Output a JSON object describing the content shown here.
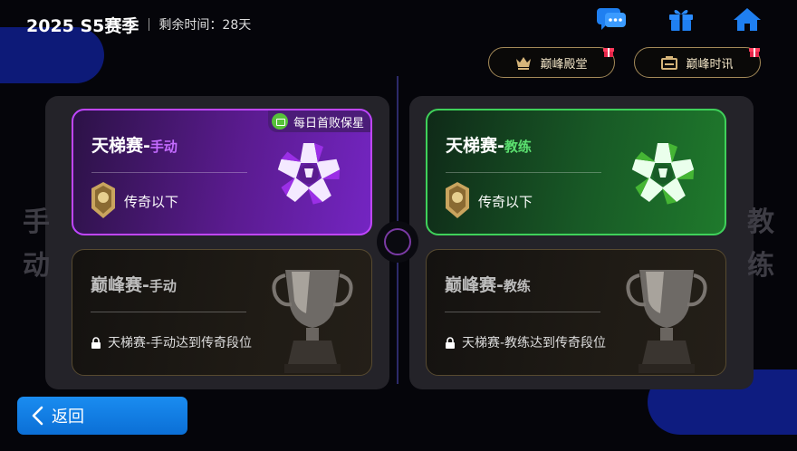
{
  "season": {
    "title": "2025 S5赛季",
    "remaining": "剩余时间：28天"
  },
  "top_icons": [
    "chat-icon",
    "gift-icon",
    "home-icon"
  ],
  "buttons": {
    "hall": {
      "label": "巅峰殿堂",
      "icon": "crown-icon"
    },
    "news": {
      "label": "巅峰时讯",
      "icon": "news-icon"
    }
  },
  "side": {
    "left": "手动",
    "right": "教练"
  },
  "cards": {
    "ladder_manual": {
      "title": "天梯赛-",
      "mode": "手动",
      "rank": "传奇以下",
      "tag": "每日首败保星",
      "accent": "#c046ff"
    },
    "ladder_coach": {
      "title": "天梯赛-",
      "mode": "教练",
      "rank": "传奇以下",
      "accent": "#3fd15a"
    },
    "peak_manual": {
      "title": "巅峰赛-",
      "mode": "手动",
      "lock": "天梯赛-手动达到传奇段位"
    },
    "peak_coach": {
      "title": "巅峰赛-",
      "mode": "教练",
      "lock": "天梯赛-教练达到传奇段位"
    }
  },
  "back": {
    "label": "返回"
  },
  "colors": {
    "accent_blue": "#1a8cf0",
    "gold": "#a48a59",
    "manual_purple": "#a64dff",
    "coach_green": "#3fd15a"
  }
}
